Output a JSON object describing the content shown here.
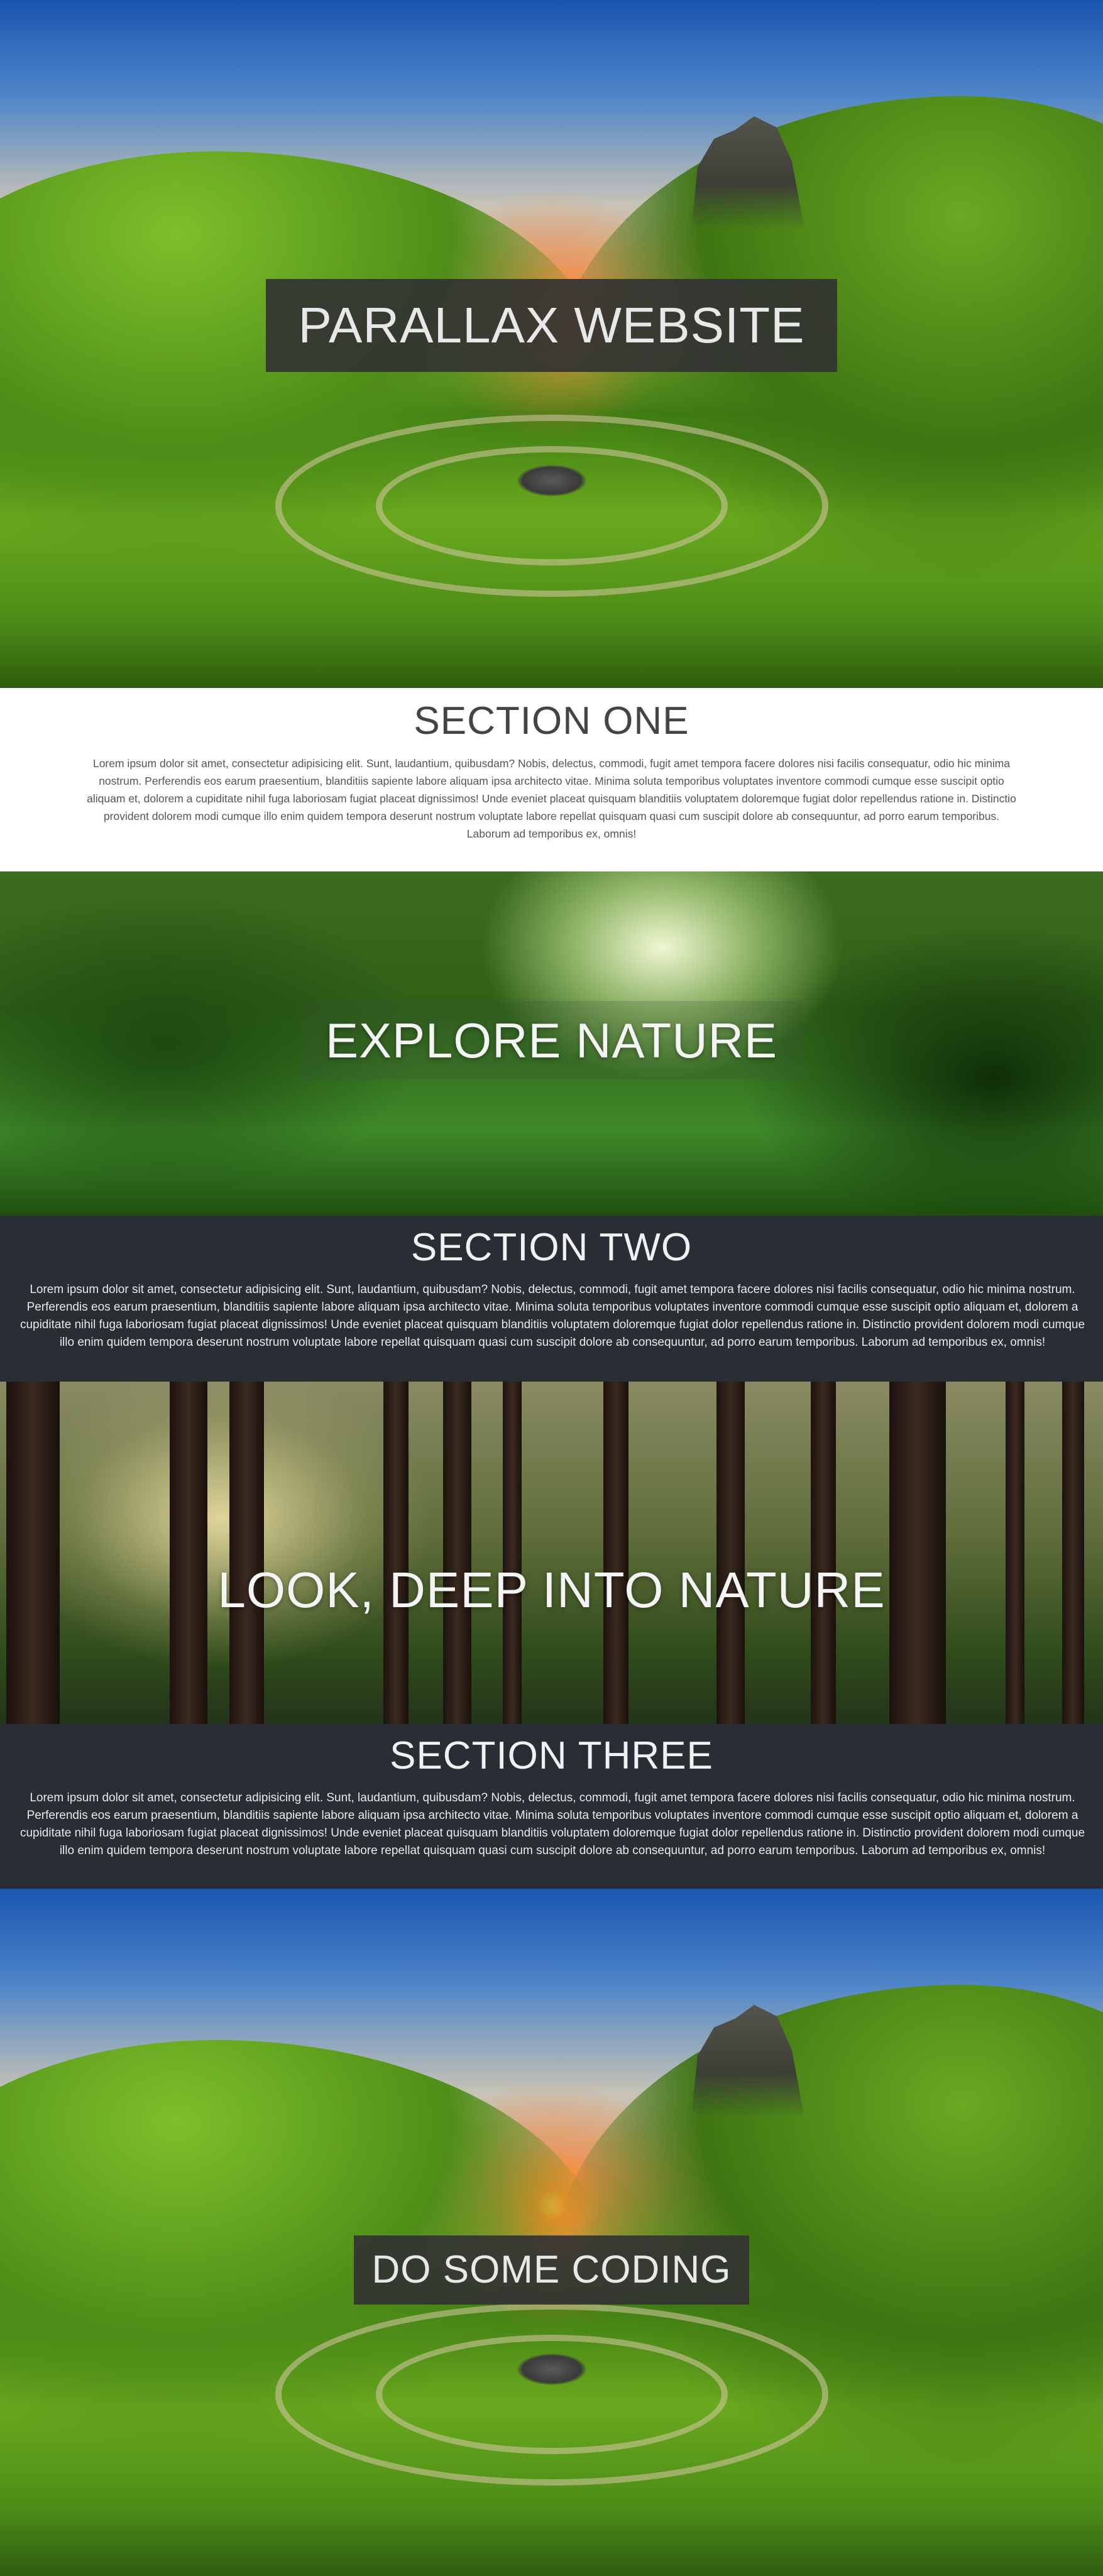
{
  "hero1": {
    "title": "PARALLAX WEBSITE"
  },
  "section1": {
    "heading": "SECTION ONE",
    "body": "Lorem ipsum dolor sit amet, consectetur adipisicing elit. Sunt, laudantium, quibusdam? Nobis, delectus, commodi, fugit amet tempora facere dolores nisi facilis consequatur, odio hic minima nostrum. Perferendis eos earum praesentium, blanditiis sapiente labore aliquam ipsa architecto vitae. Minima soluta temporibus voluptates inventore commodi cumque esse suscipit optio aliquam et, dolorem a cupiditate nihil fuga laboriosam fugiat placeat dignissimos! Unde eveniet placeat quisquam blanditiis voluptatem doloremque fugiat dolor repellendus ratione in. Distinctio provident dolorem modi cumque illo enim quidem tempora deserunt nostrum voluptate labore repellat quisquam quasi cum suscipit dolore ab consequuntur, ad porro earum temporibus. Laborum ad temporibus ex, omnis!"
  },
  "hero2": {
    "title": "EXPLORE NATURE"
  },
  "section2": {
    "heading": "SECTION TWO",
    "body": "Lorem ipsum dolor sit amet, consectetur adipisicing elit. Sunt, laudantium, quibusdam? Nobis, delectus, commodi, fugit amet tempora facere dolores nisi facilis consequatur, odio hic minima nostrum. Perferendis eos earum praesentium, blanditiis sapiente labore aliquam ipsa architecto vitae. Minima soluta temporibus voluptates inventore commodi cumque esse suscipit optio aliquam et, dolorem a cupiditate nihil fuga laboriosam fugiat placeat dignissimos! Unde eveniet placeat quisquam blanditiis voluptatem doloremque fugiat dolor repellendus ratione in. Distinctio provident dolorem modi cumque illo enim quidem tempora deserunt nostrum voluptate labore repellat quisquam quasi cum suscipit dolore ab consequuntur, ad porro earum temporibus. Laborum ad temporibus ex, omnis!"
  },
  "hero3": {
    "title": "LOOK, DEEP INTO NATURE"
  },
  "section3": {
    "heading": "SECTION THREE",
    "body": "Lorem ipsum dolor sit amet, consectetur adipisicing elit. Sunt, laudantium, quibusdam? Nobis, delectus, commodi, fugit amet tempora facere dolores nisi facilis consequatur, odio hic minima nostrum. Perferendis eos earum praesentium, blanditiis sapiente labore aliquam ipsa architecto vitae. Minima soluta temporibus voluptates inventore commodi cumque esse suscipit optio aliquam et, dolorem a cupiditate nihil fuga laboriosam fugiat placeat dignissimos! Unde eveniet placeat quisquam blanditiis voluptatem doloremque fugiat dolor repellendus ratione in. Distinctio provident dolorem modi cumque illo enim quidem tempora deserunt nostrum voluptate labore repellat quisquam quasi cum suscipit dolore ab consequuntur, ad porro earum temporibus. Laborum ad temporibus ex, omnis!"
  },
  "hero4": {
    "title": "DO SOME CODING"
  }
}
